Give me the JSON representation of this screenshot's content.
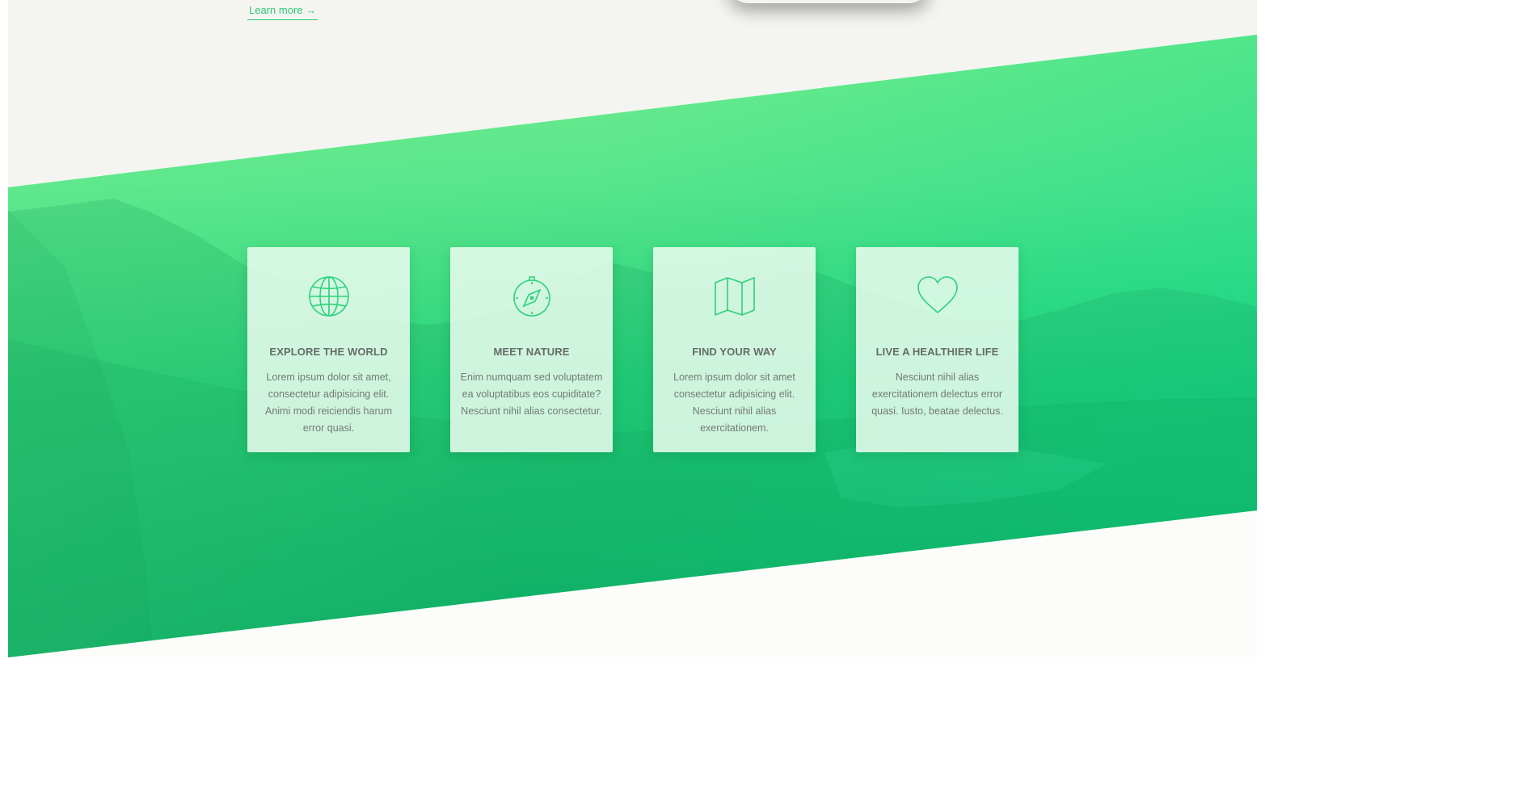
{
  "top": {
    "learn_more_label": "Learn more →"
  },
  "colors": {
    "accent": "#2ec877",
    "hero_top": "#78ee8a",
    "hero_bottom": "#0bb96c",
    "card_bg": "#ebfcf0",
    "icon_stroke": "#2ed17c",
    "title_text": "#666b68",
    "body_text": "#727a75"
  },
  "features": [
    {
      "icon": "globe-icon",
      "title": "EXPLORE THE WORLD",
      "text": "Lorem ipsum dolor sit amet, consectetur adipisicing elit. Animi modi reiciendis harum error quasi."
    },
    {
      "icon": "compass-icon",
      "title": "MEET NATURE",
      "text": "Enim numquam sed voluptatem ea voluptatibus eos cupiditate? Nesciunt nihil alias consectetur."
    },
    {
      "icon": "map-icon",
      "title": "FIND YOUR WAY",
      "text": "Lorem ipsum dolor sit amet consectetur adipisicing elit. Nesciunt nihil alias exercitationem."
    },
    {
      "icon": "heart-icon",
      "title": "LIVE A HEALTHIER LIFE",
      "text": "Nesciunt nihil alias exercitationem delectus error quasi. Iusto, beatae delectus."
    }
  ]
}
